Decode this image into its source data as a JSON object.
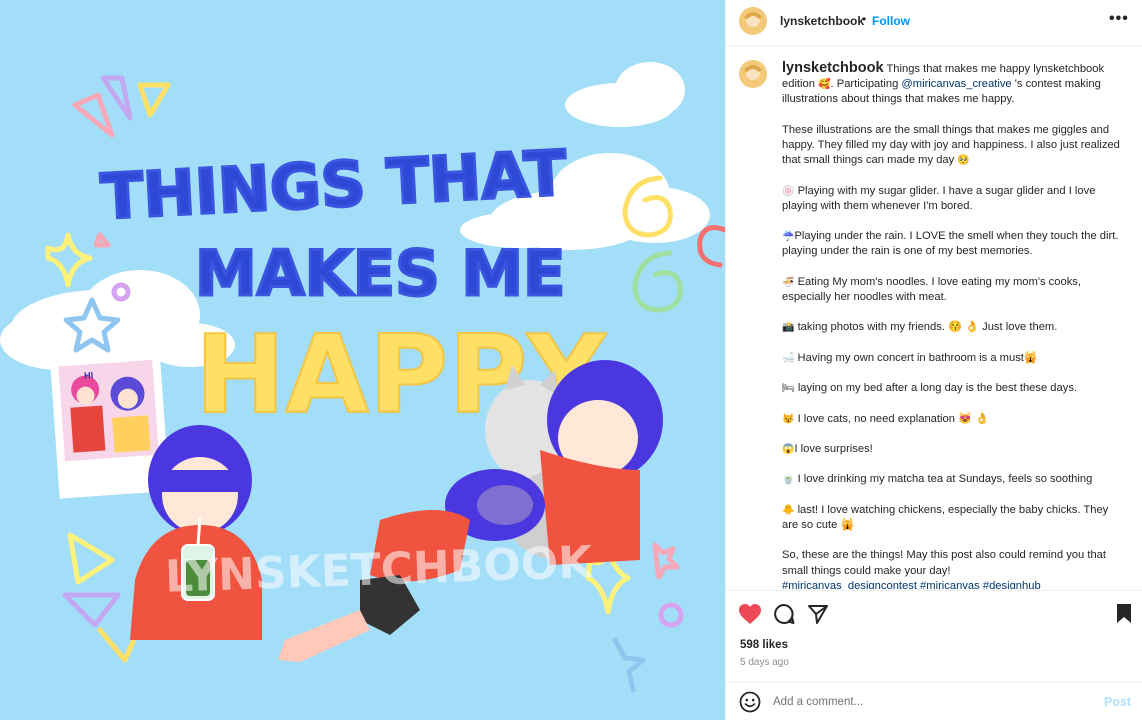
{
  "post": {
    "artwork": {
      "title_lines": [
        "THINGS THAT",
        "MAKES ME",
        "HAPPY"
      ],
      "watermark": "LYNSKETCHBOOK",
      "photo_sign": "HI"
    },
    "header": {
      "username": "lynsketchbook",
      "separator": "•",
      "follow_label": "Follow",
      "more_glyph": "•••"
    },
    "caption": {
      "username": "lynsketchbook",
      "intro_a": "Things that makes me happy lynsketchbook edition",
      "intro_b": ". Participating",
      "mention": "@miricanvas_creative",
      "intro_c": "'s contest making illustrations about things that makes me happy.",
      "para1": "These illustrations are the small things that makes me giggles and happy. They filled my day with joy and happiness. I also just realized that small things can made my day",
      "items": [
        {
          "emoji": "🍥",
          "text": "Playing with my sugar glider. I have a sugar glider and I love playing with them whenever I'm bored."
        },
        {
          "emoji": "☔",
          "text": "Playing under the rain. I LOVE the smell when they touch the dirt. playing under the rain is one of my best memories."
        },
        {
          "emoji": "🍜",
          "text": "Eating My mom's noodles. I love eating my mom's cooks, especially her noodles with meat."
        },
        {
          "emoji": "📸",
          "text": "taking photos with my friends. 😚 👌 Just love them."
        },
        {
          "emoji": "🛁",
          "text": " Having my own concert in bathroom is a must🙀"
        },
        {
          "emoji": "🛏",
          "text": "laying on my bed after a long day is the best these days."
        },
        {
          "emoji": "😾",
          "text": "I love cats, no need explanation 😻 👌"
        },
        {
          "emoji": "😱",
          "text": "I love surprises!"
        },
        {
          "emoji": "🍵",
          "text": "I love drinking my matcha tea at Sundays, feels so soothing"
        },
        {
          "emoji": "🐥",
          "text": "last! I love watching chickens, especially the baby chicks. They are so cute 🙀"
        }
      ],
      "outro": "So, these are the things! May this post also could remind you that small things could make your day!",
      "hashtags": "#miricanvas_designcontest #miricanvas #designhub"
    },
    "actions": {
      "likes": "598 likes",
      "time_ago": "5 days ago"
    },
    "comment": {
      "placeholder": "Add a comment...",
      "post_label": "Post"
    },
    "colors": {
      "accent_blue": "#0095f6",
      "like_red": "#ed4956",
      "sky": "#a3def8"
    },
    "icons": [
      "heart-icon",
      "comment-icon",
      "share-icon",
      "bookmark-icon",
      "emoji-icon",
      "more-icon"
    ]
  }
}
